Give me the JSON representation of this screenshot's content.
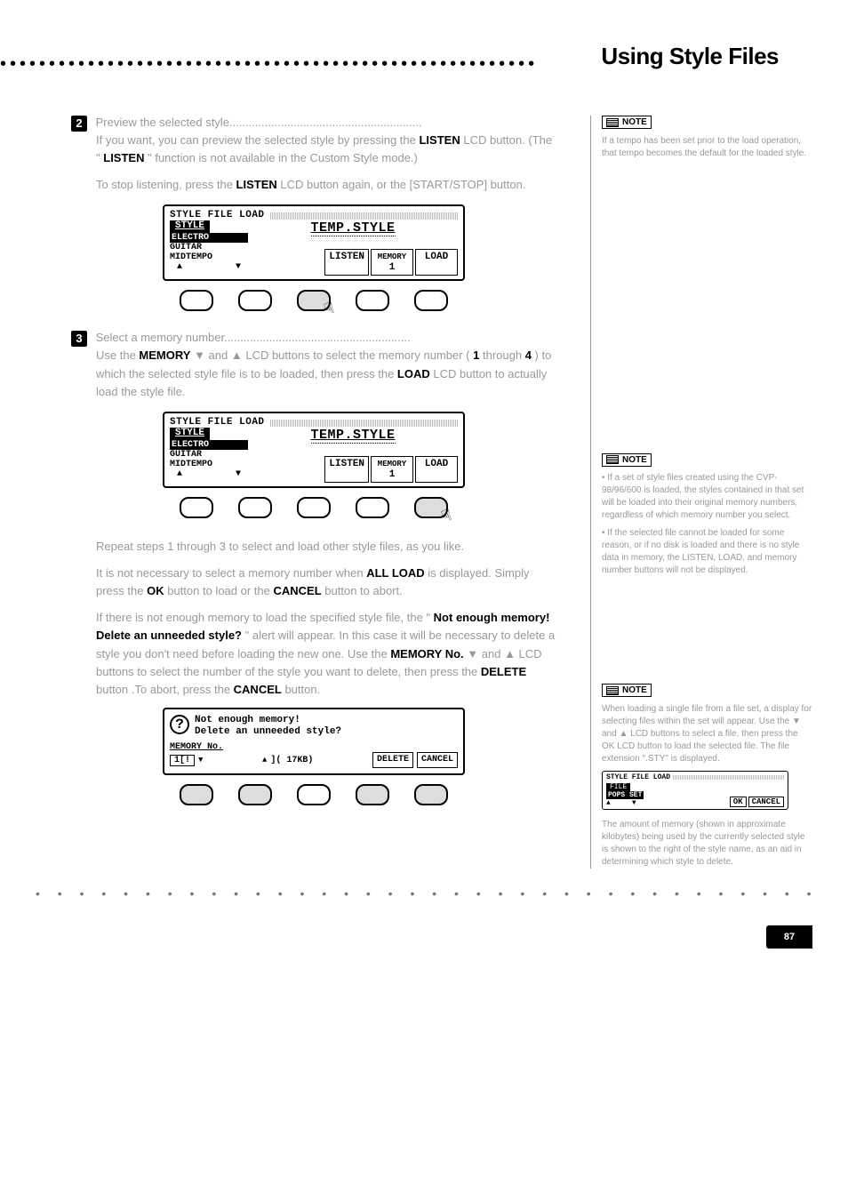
{
  "page": {
    "title": "Using Style Files",
    "page_number": "87"
  },
  "step2": {
    "num": "2",
    "text_intro": "If you want, you can preview the selected style by pressing the ",
    "text_listen1": "LISTEN",
    "text_mid1": " LCD button. (The \"",
    "text_listen2": "LISTEN",
    "text_mid2": "\" function is not available in the Custom Style mode.)",
    "text_stop": "To stop listening, press the ",
    "text_listen3": "LISTEN",
    "text_end": " LCD button again, or the [START/STOP] button."
  },
  "lcd": {
    "title": "STYLE FILE LOAD",
    "tempstyle": "TEMP.STYLE",
    "style_hdr": "STYLE",
    "styles": {
      "row1": "ELECTRO",
      "row2": "GUITAR",
      "row3": "MIDTEMPO"
    },
    "arrow_up": "▲",
    "arrow_down": "▼",
    "listen": "LISTEN",
    "memory": "MEMORY",
    "memory_num": "1",
    "load": "LOAD"
  },
  "note2": {
    "label": "NOTE",
    "text": "If a tempo has been set prior to the load operation, that tempo becomes the default for the loaded style."
  },
  "step3": {
    "num": "3",
    "text_a": "Select a memory number..........................................................",
    "text_body1": "Use the ",
    "mem": "MEMORY",
    "text_body2": " ▼ and ▲ LCD buttons to select the memory number (",
    "one": "1",
    "thru": " through ",
    "four": "4",
    "text_body3": ") to which the selected style file is to be loaded, then press the ",
    "load": "LOAD",
    "text_body4": " LCD button to actually load the style file."
  },
  "note3": {
    "label": "NOTE",
    "lines": {
      "a": "If a set of style files created using the CVP-98/96/600 is loaded, the styles contained in that set will be loaded into their original memory numbers, regardless of which memory number you select.",
      "b": "If the selected file cannot be loaded for some reason, or if no disk is loaded and there is no style data in memory, the LISTEN, LOAD, and memory number buttons will not be displayed."
    }
  },
  "extra": {
    "text1": "Repeat steps 1 through 3 to select and load other style files, as you like.",
    "text2a": "It is not necessary to select a memory number when ",
    "allload": "ALL LOAD",
    "text2b": " is displayed. Simply press the ",
    "ok": "OK",
    "text2c": " button to load or the ",
    "cancel": "CANCEL",
    "text2d": " button to abort.",
    "text3a": "If there is not enough memory to load the specified style file, the \"",
    "warn": "Not enough memory! Delete an unneeded style?",
    "text3b": "\" alert will appear. In this case it will be necessary to delete a style you don't need before loading the new one. Use the ",
    "memno": "MEMORY No.",
    "text3c": " ▼ and ▲ LCD buttons to select the number of the style you want to delete, then press the ",
    "delete": "DELETE",
    "text3d": " button .To abort, press the ",
    "cancel2": "CANCEL",
    "text3e": " button."
  },
  "note4": {
    "label": "NOTE",
    "line1": "When loading a single file from a file set, a display for selecting files within the set will appear. Use the ▼ and ▲ LCD buttons to select a file, then press the OK LCD button to load the selected file. The file extension \".STY\" is displayed.",
    "line2": "The amount of memory (shown in approximate kilobytes) being used by the currently selected style is shown to the right of the style name, as an aid in determining which style to delete."
  },
  "mini": {
    "title": "STYLE FILE LOAD",
    "file_hdr": "FILE",
    "file_name": "POPS SET",
    "ok": "OK",
    "cancel": "CANCEL"
  },
  "warnlcd": {
    "line1": "Not enough memory!",
    "line2": "Delete an unneeded style?",
    "memlabel": "MEMORY No.",
    "slot": "1[!",
    "size": "]( 17KB)",
    "delete": "DELETE",
    "cancel": "CANCEL"
  }
}
